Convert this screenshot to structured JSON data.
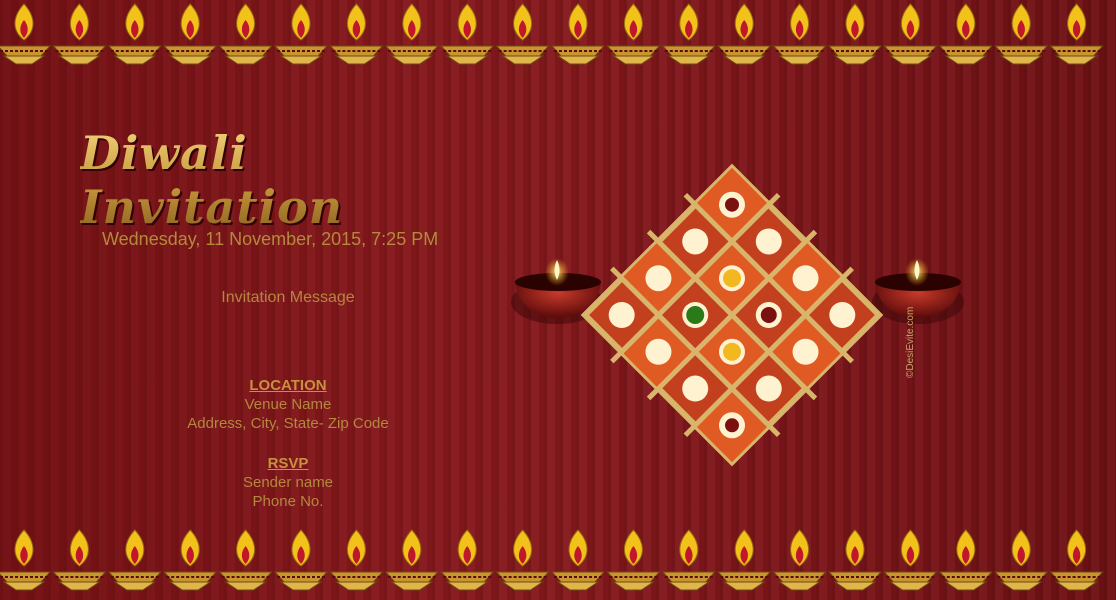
{
  "title": "Diwali Invitation",
  "datetime": "Wednesday, 11 November, 2015, 7:25 PM",
  "message": "Invitation Message",
  "location": {
    "heading": "LOCATION",
    "venue": "Venue Name",
    "address": "Address, City, State- Zip Code"
  },
  "rsvp": {
    "heading": "RSVP",
    "sender": "Sender name",
    "phone": "Phone No."
  },
  "credit": "©DesiEvite.com",
  "colors": {
    "background": "#7c1519",
    "text_gold": "#b4883e",
    "flame": "#f2c21a"
  },
  "icons": [
    "diya-lamp-icon",
    "om-icon",
    "swastik-icon",
    "kalash-icon",
    "trishul-icon",
    "lotus-icon",
    "clay-lamp-icon"
  ]
}
